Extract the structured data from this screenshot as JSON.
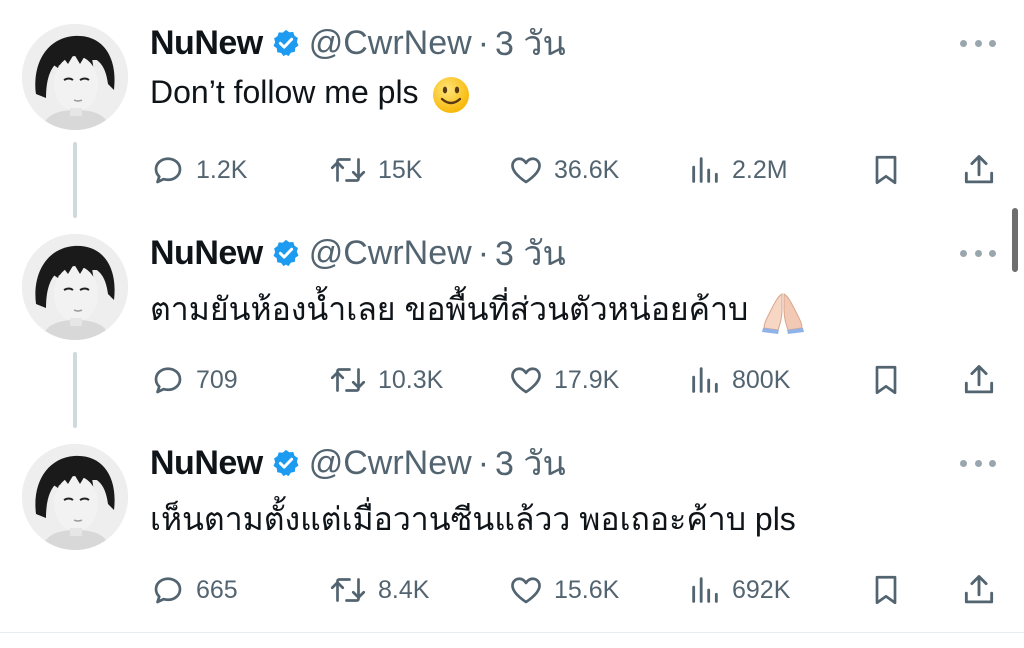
{
  "tweets": [
    {
      "name": "NuNew",
      "handle": "@CwrNew",
      "separator": "·",
      "time": "3 วัน",
      "text": "Don’t follow me pls",
      "emoji": "slightly-smiling-face",
      "replies": "1.2K",
      "retweets": "15K",
      "likes": "36.6K",
      "views": "2.2M"
    },
    {
      "name": "NuNew",
      "handle": "@CwrNew",
      "separator": "·",
      "time": "3 วัน",
      "text": "ตามยันห้องน้ำเลย ขอพื้นที่ส่วนตัวหน่อยค้าบ",
      "emoji": "folded-hands",
      "replies": "709",
      "retweets": "10.3K",
      "likes": "17.9K",
      "views": "800K"
    },
    {
      "name": "NuNew",
      "handle": "@CwrNew",
      "separator": "·",
      "time": "3 วัน",
      "text": "เห็นตามตั้งแต่เมื่อวานซีนแล้วว พอเถอะค้าบ pls",
      "emoji": "",
      "replies": "665",
      "retweets": "8.4K",
      "likes": "15.6K",
      "views": "692K"
    }
  ],
  "icons": {
    "verified": "verified-badge-icon",
    "more": "more-dots-icon",
    "reply": "reply-bubble-icon",
    "retweet": "retweet-icon",
    "like": "heart-icon",
    "views": "views-bars-icon",
    "bookmark": "bookmark-icon",
    "share": "share-upload-icon"
  },
  "colors": {
    "verified_blue": "#1d9bf0",
    "secondary_text": "#536471",
    "thread_line": "#cfd9de"
  }
}
